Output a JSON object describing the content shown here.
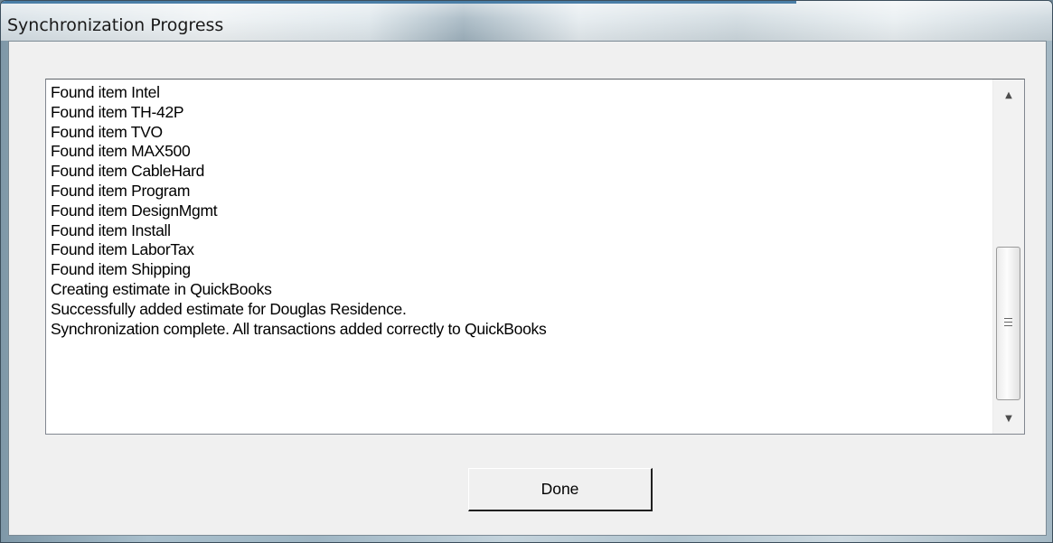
{
  "window": {
    "title": "Synchronization Progress"
  },
  "log": {
    "lines": [
      "Found item Intel",
      "Found item TH-42P",
      "Found item TVO",
      "Found item MAX500",
      "Found item CableHard",
      "Found item Program",
      "Found item DesignMgmt",
      "Found item Install",
      "Found item LaborTax",
      "Found item Shipping",
      "Creating estimate in QuickBooks",
      "Successfully added estimate for Douglas Residence.",
      "Synchronization complete. All transactions added correctly to QuickBooks"
    ]
  },
  "icons": {
    "scroll_up": "scroll-up-arrow-icon",
    "scroll_down": "scroll-down-arrow-icon",
    "thumb_grip": "scroll-grip-icon"
  },
  "buttons": {
    "done_label": "Done"
  },
  "colors": {
    "titlebar_accent": "#4a7ea7",
    "dialog_background": "#f0f0f0",
    "log_background": "#ffffff"
  }
}
